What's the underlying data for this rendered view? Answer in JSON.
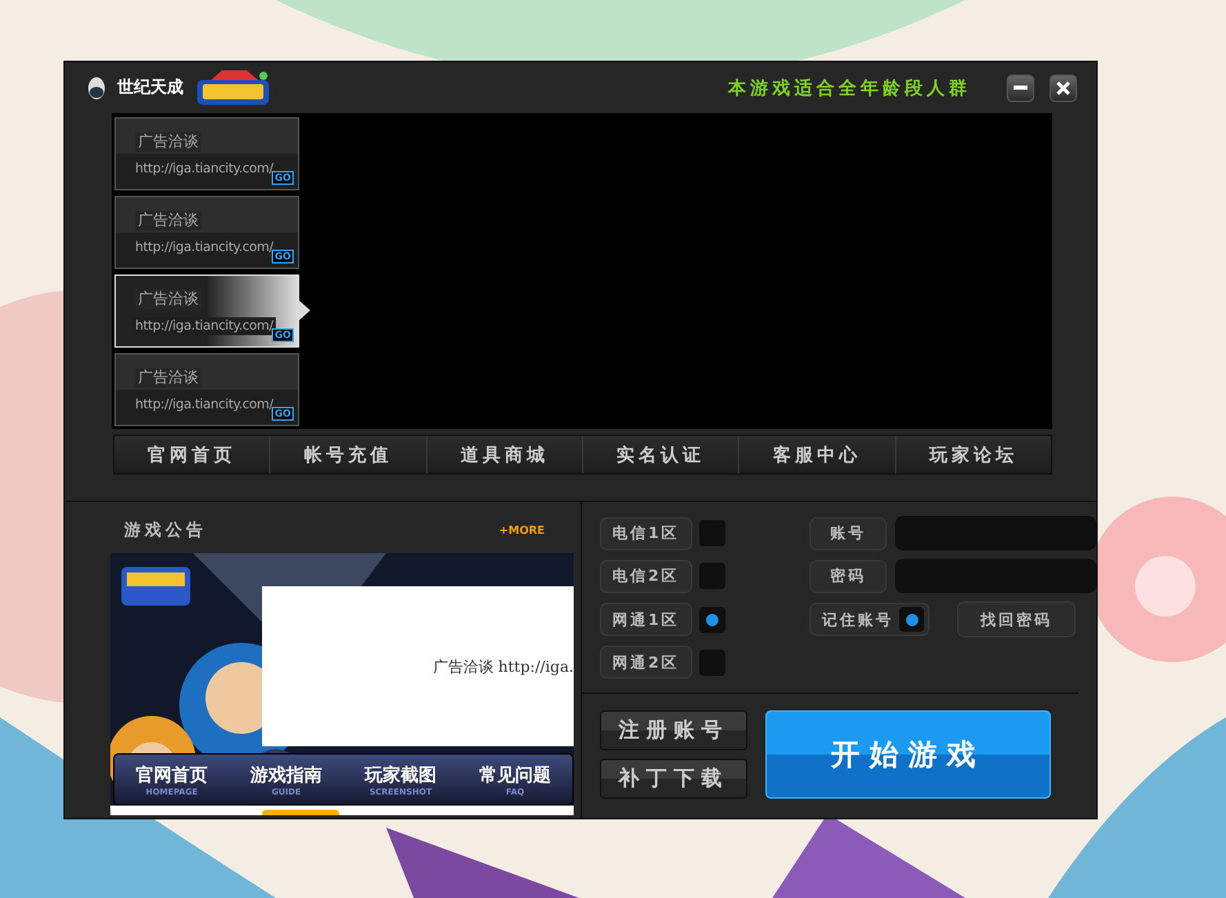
{
  "window": {
    "logo_text": "世纪天成",
    "tagline": "本游戏适合全年龄段人群"
  },
  "ads": [
    {
      "title": "广告洽谈",
      "url": "http://iga.tiancity.com/",
      "go": "GO",
      "selected": false
    },
    {
      "title": "广告洽谈",
      "url": "http://iga.tiancity.com/",
      "go": "GO",
      "selected": false
    },
    {
      "title": "广告洽谈",
      "url": "http://iga.tiancity.com/",
      "go": "GO",
      "selected": true
    },
    {
      "title": "广告洽谈",
      "url": "http://iga.tiancity.com/",
      "go": "GO",
      "selected": false
    }
  ],
  "nav": [
    "官网首页",
    "帐号充值",
    "道具商城",
    "实名认证",
    "客服中心",
    "玩家论坛"
  ],
  "notice": {
    "title": "游戏公告",
    "more": "+MORE",
    "ad_text": "广告洽谈 http://iga.",
    "links": [
      {
        "label": "官网首页",
        "sub": "HOMEPAGE"
      },
      {
        "label": "游戏指南",
        "sub": "GUIDE"
      },
      {
        "label": "玩家截图",
        "sub": "SCREENSHOT"
      },
      {
        "label": "常见问题",
        "sub": "FAQ"
      }
    ]
  },
  "servers": [
    {
      "label": "电信1区",
      "selected": false
    },
    {
      "label": "电信2区",
      "selected": false
    },
    {
      "label": "网通1区",
      "selected": true
    },
    {
      "label": "网通2区",
      "selected": false
    }
  ],
  "login": {
    "account_label": "账号",
    "password_label": "密码",
    "remember": {
      "label": "记住账号",
      "checked": true
    },
    "recover": "找回密码"
  },
  "buttons": {
    "register": "注册账号",
    "patch": "补丁下载",
    "start": "开始游戏"
  }
}
